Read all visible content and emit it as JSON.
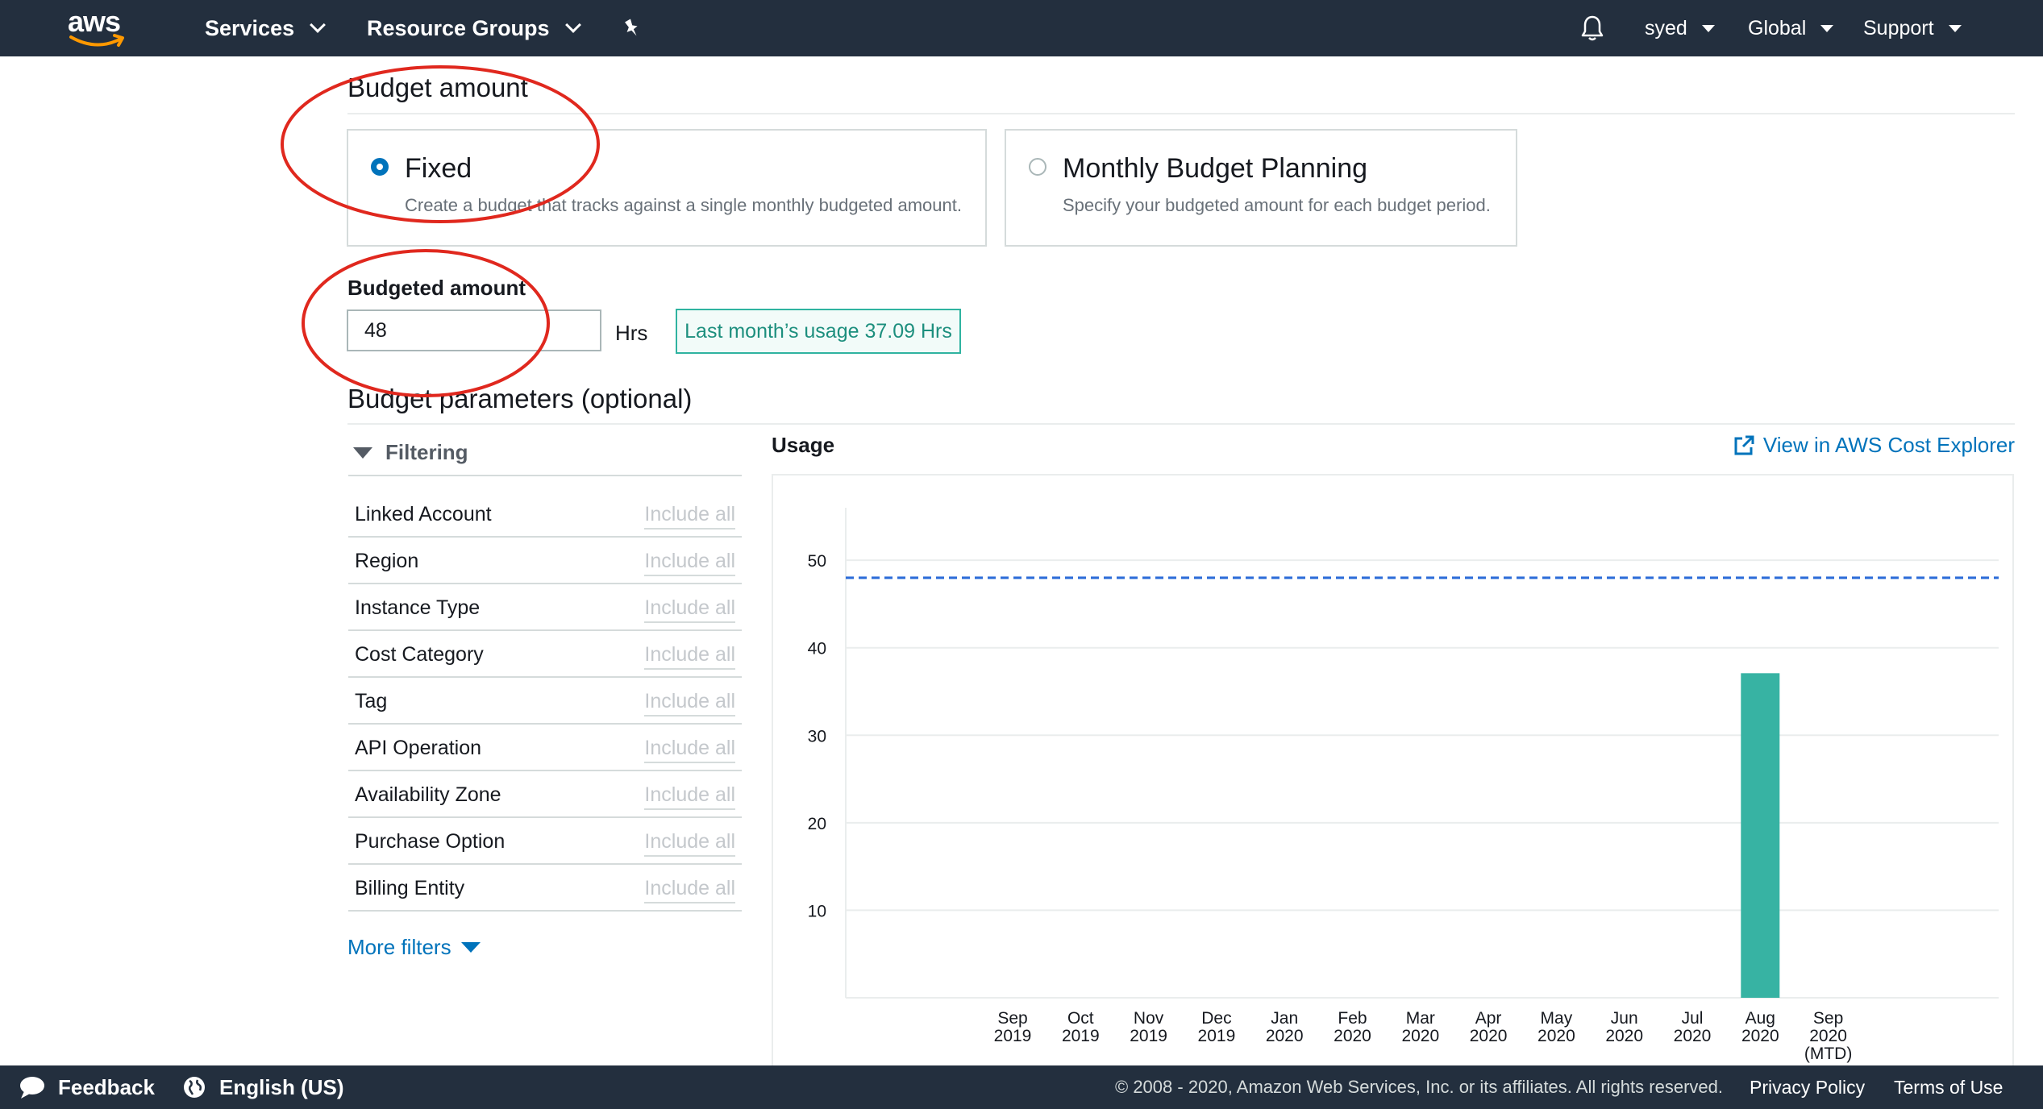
{
  "nav": {
    "logo": "aws",
    "services": "Services",
    "resource_groups": "Resource Groups",
    "pin_icon": "pin-icon",
    "bell_icon": "bell-icon",
    "user": "syed",
    "region": "Global",
    "support": "Support"
  },
  "budget_amount": {
    "heading": "Budget amount",
    "options": [
      {
        "title": "Fixed",
        "description": "Create a budget that tracks against a single monthly budgeted amount.",
        "selected": true
      },
      {
        "title": "Monthly Budget Planning",
        "description": "Specify your budgeted amount for each budget period.",
        "selected": false
      }
    ]
  },
  "budgeted_amount": {
    "label": "Budgeted amount",
    "value": "48",
    "unit": "Hrs",
    "last_month": "Last month’s usage 37.09 Hrs"
  },
  "parameters": {
    "heading": "Budget parameters (optional)",
    "filtering_label": "Filtering",
    "filters": [
      {
        "name": "Linked Account",
        "value": "Include all"
      },
      {
        "name": "Region",
        "value": "Include all"
      },
      {
        "name": "Instance Type",
        "value": "Include all"
      },
      {
        "name": "Cost Category",
        "value": "Include all"
      },
      {
        "name": "Tag",
        "value": "Include all"
      },
      {
        "name": "API Operation",
        "value": "Include all"
      },
      {
        "name": "Availability Zone",
        "value": "Include all"
      },
      {
        "name": "Purchase Option",
        "value": "Include all"
      },
      {
        "name": "Billing Entity",
        "value": "Include all"
      }
    ],
    "more_filters": "More filters"
  },
  "usage": {
    "title": "Usage",
    "explorer_link": "View in AWS Cost Explorer"
  },
  "chart_data": {
    "type": "bar",
    "categories": [
      [
        "Sep",
        "2019"
      ],
      [
        "Oct",
        "2019"
      ],
      [
        "Nov",
        "2019"
      ],
      [
        "Dec",
        "2019"
      ],
      [
        "Jan",
        "2020"
      ],
      [
        "Feb",
        "2020"
      ],
      [
        "Mar",
        "2020"
      ],
      [
        "Apr",
        "2020"
      ],
      [
        "May",
        "2020"
      ],
      [
        "Jun",
        "2020"
      ],
      [
        "Jul",
        "2020"
      ],
      [
        "Aug",
        "2020"
      ],
      [
        "Sep",
        "2020",
        "(MTD)"
      ]
    ],
    "values": [
      0,
      0,
      0,
      0,
      0,
      0,
      0,
      0,
      0,
      0,
      0,
      37.09,
      0
    ],
    "budget_line": 48,
    "yticks": [
      10,
      20,
      30,
      40,
      50
    ],
    "ylim": [
      0,
      56
    ],
    "grid": true,
    "bar_color": "#37b3a3",
    "budget_line_color": "#2a6bd8"
  },
  "footer": {
    "feedback": "Feedback",
    "language": "English (US)",
    "copyright": "© 2008 - 2020, Amazon Web Services, Inc. or its affiliates. All rights reserved.",
    "privacy": "Privacy Policy",
    "terms": "Terms of Use"
  },
  "colors": {
    "nav_bg": "#232f3e",
    "link": "#0073bb",
    "annotation": "#e0281e"
  }
}
